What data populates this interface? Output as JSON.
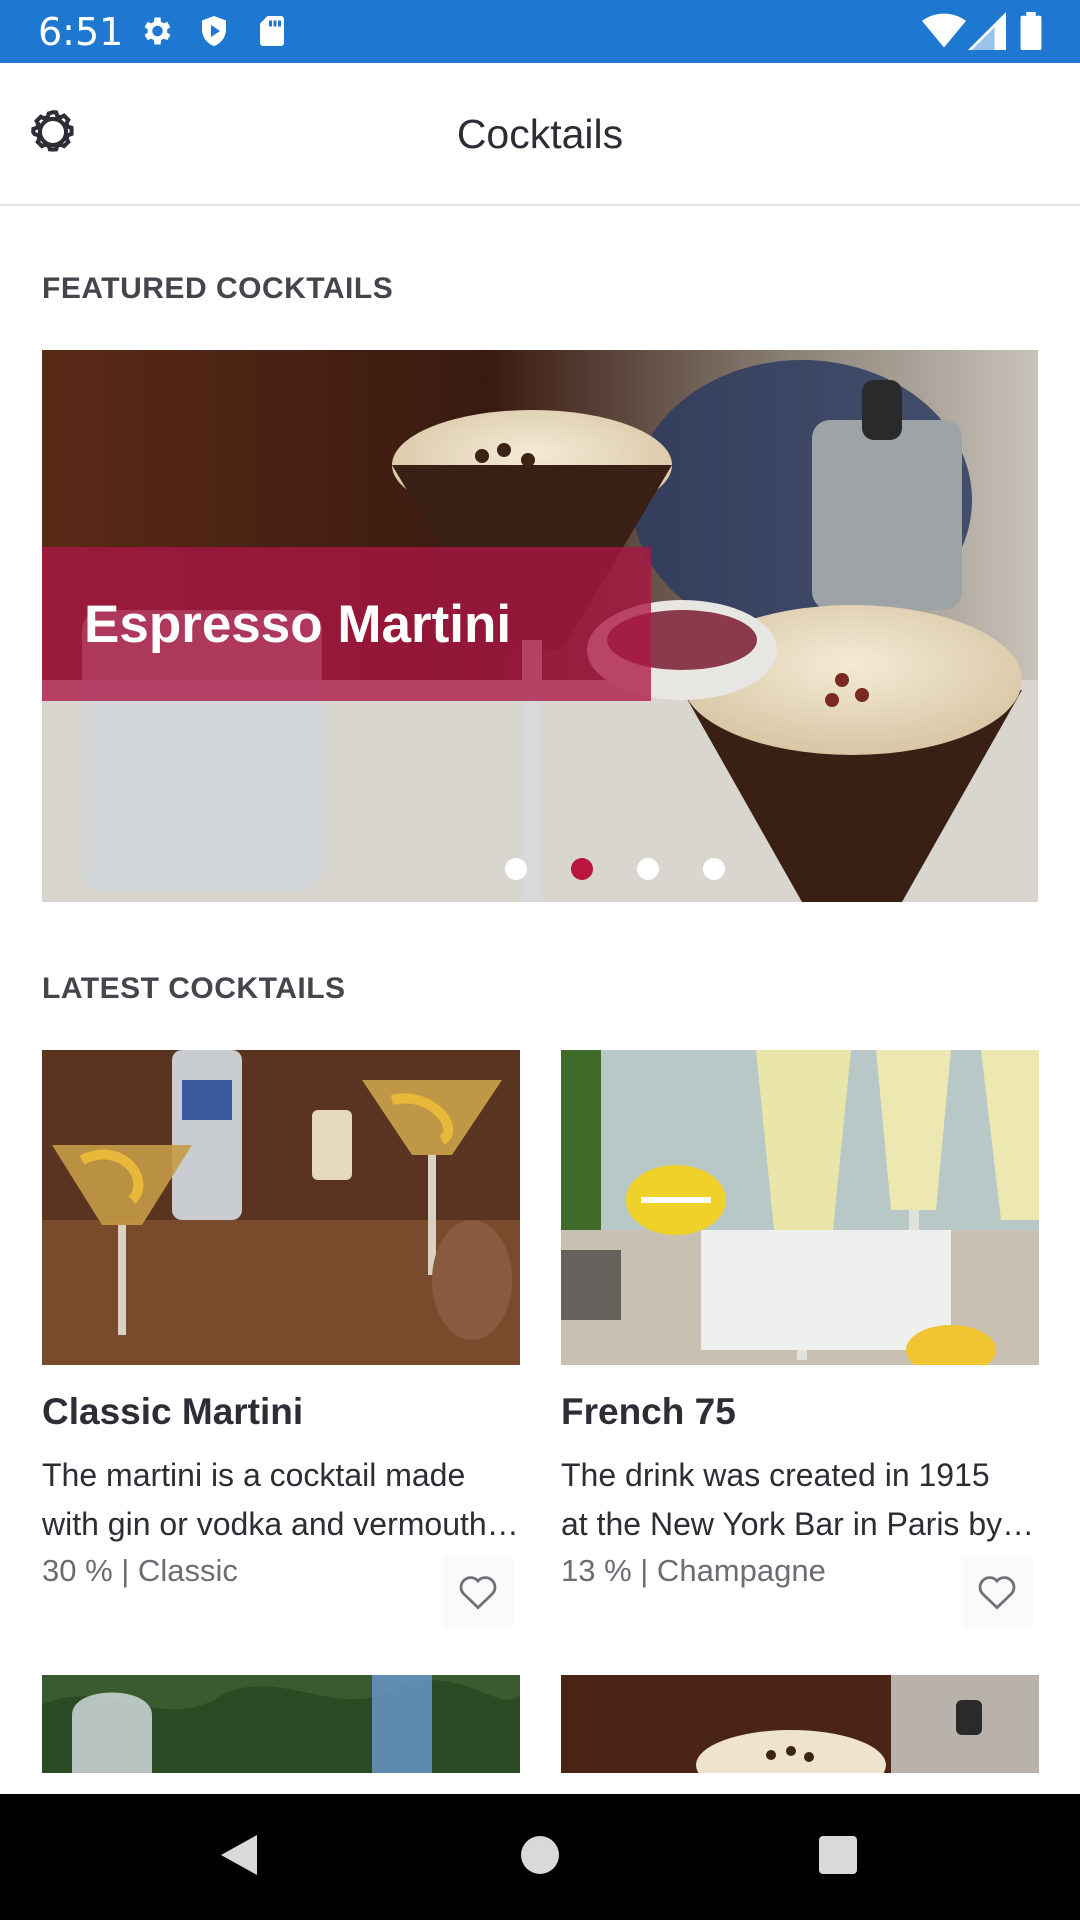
{
  "status_bar": {
    "time": "6:51",
    "left_icons": [
      "gear-icon",
      "shield-icon",
      "sd-card-icon"
    ],
    "right_icons": [
      "wifi-icon",
      "signal-icon",
      "battery-icon"
    ],
    "background": "#1e78d2"
  },
  "app_bar": {
    "title": "Cocktails",
    "settings_icon": "gear-icon"
  },
  "featured": {
    "section_title": "FEATURED COCKTAILS",
    "caption": "Espresso Martini",
    "caption_color": "#ac1644",
    "dots_total": 4,
    "active_dot": 2
  },
  "latest": {
    "section_title": "LATEST COCKTAILS",
    "cards": [
      {
        "title": "Classic Martini",
        "desc_line1": "The martini is a cocktail made",
        "desc_line2": "with gin or vodka and vermouth and garnished",
        "meta": "30 % | Classic",
        "favorite_icon": "heart-outline-icon"
      },
      {
        "title": "French 75",
        "desc_line1": "The drink was created in 1915",
        "desc_line2": "at the New York Bar in Paris by Harry MacElhone",
        "meta": "13 % | Champagne",
        "favorite_icon": "heart-outline-icon"
      }
    ]
  },
  "nav_bar": {
    "icons": [
      "back-icon",
      "home-icon",
      "recents-icon"
    ]
  }
}
